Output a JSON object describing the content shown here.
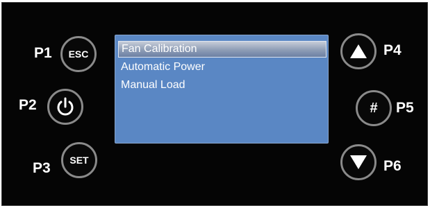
{
  "labels": {
    "p1": "P1",
    "p2": "P2",
    "p3": "P3",
    "p4": "P4",
    "p5": "P5",
    "p6": "P6"
  },
  "buttons": {
    "esc": "ESC",
    "set": "SET",
    "hash": "#",
    "power_icon": "power-icon",
    "up_icon": "arrow-up-icon",
    "down_icon": "arrow-down-icon"
  },
  "menu": {
    "items": [
      "Fan Calibration",
      "Automatic Power",
      "Manual Load"
    ],
    "selected_index": 0
  },
  "colors": {
    "panel": "#050505",
    "screen": "#5a87c4",
    "button_ring": "#8a8a8a",
    "text": "#ffffff"
  }
}
